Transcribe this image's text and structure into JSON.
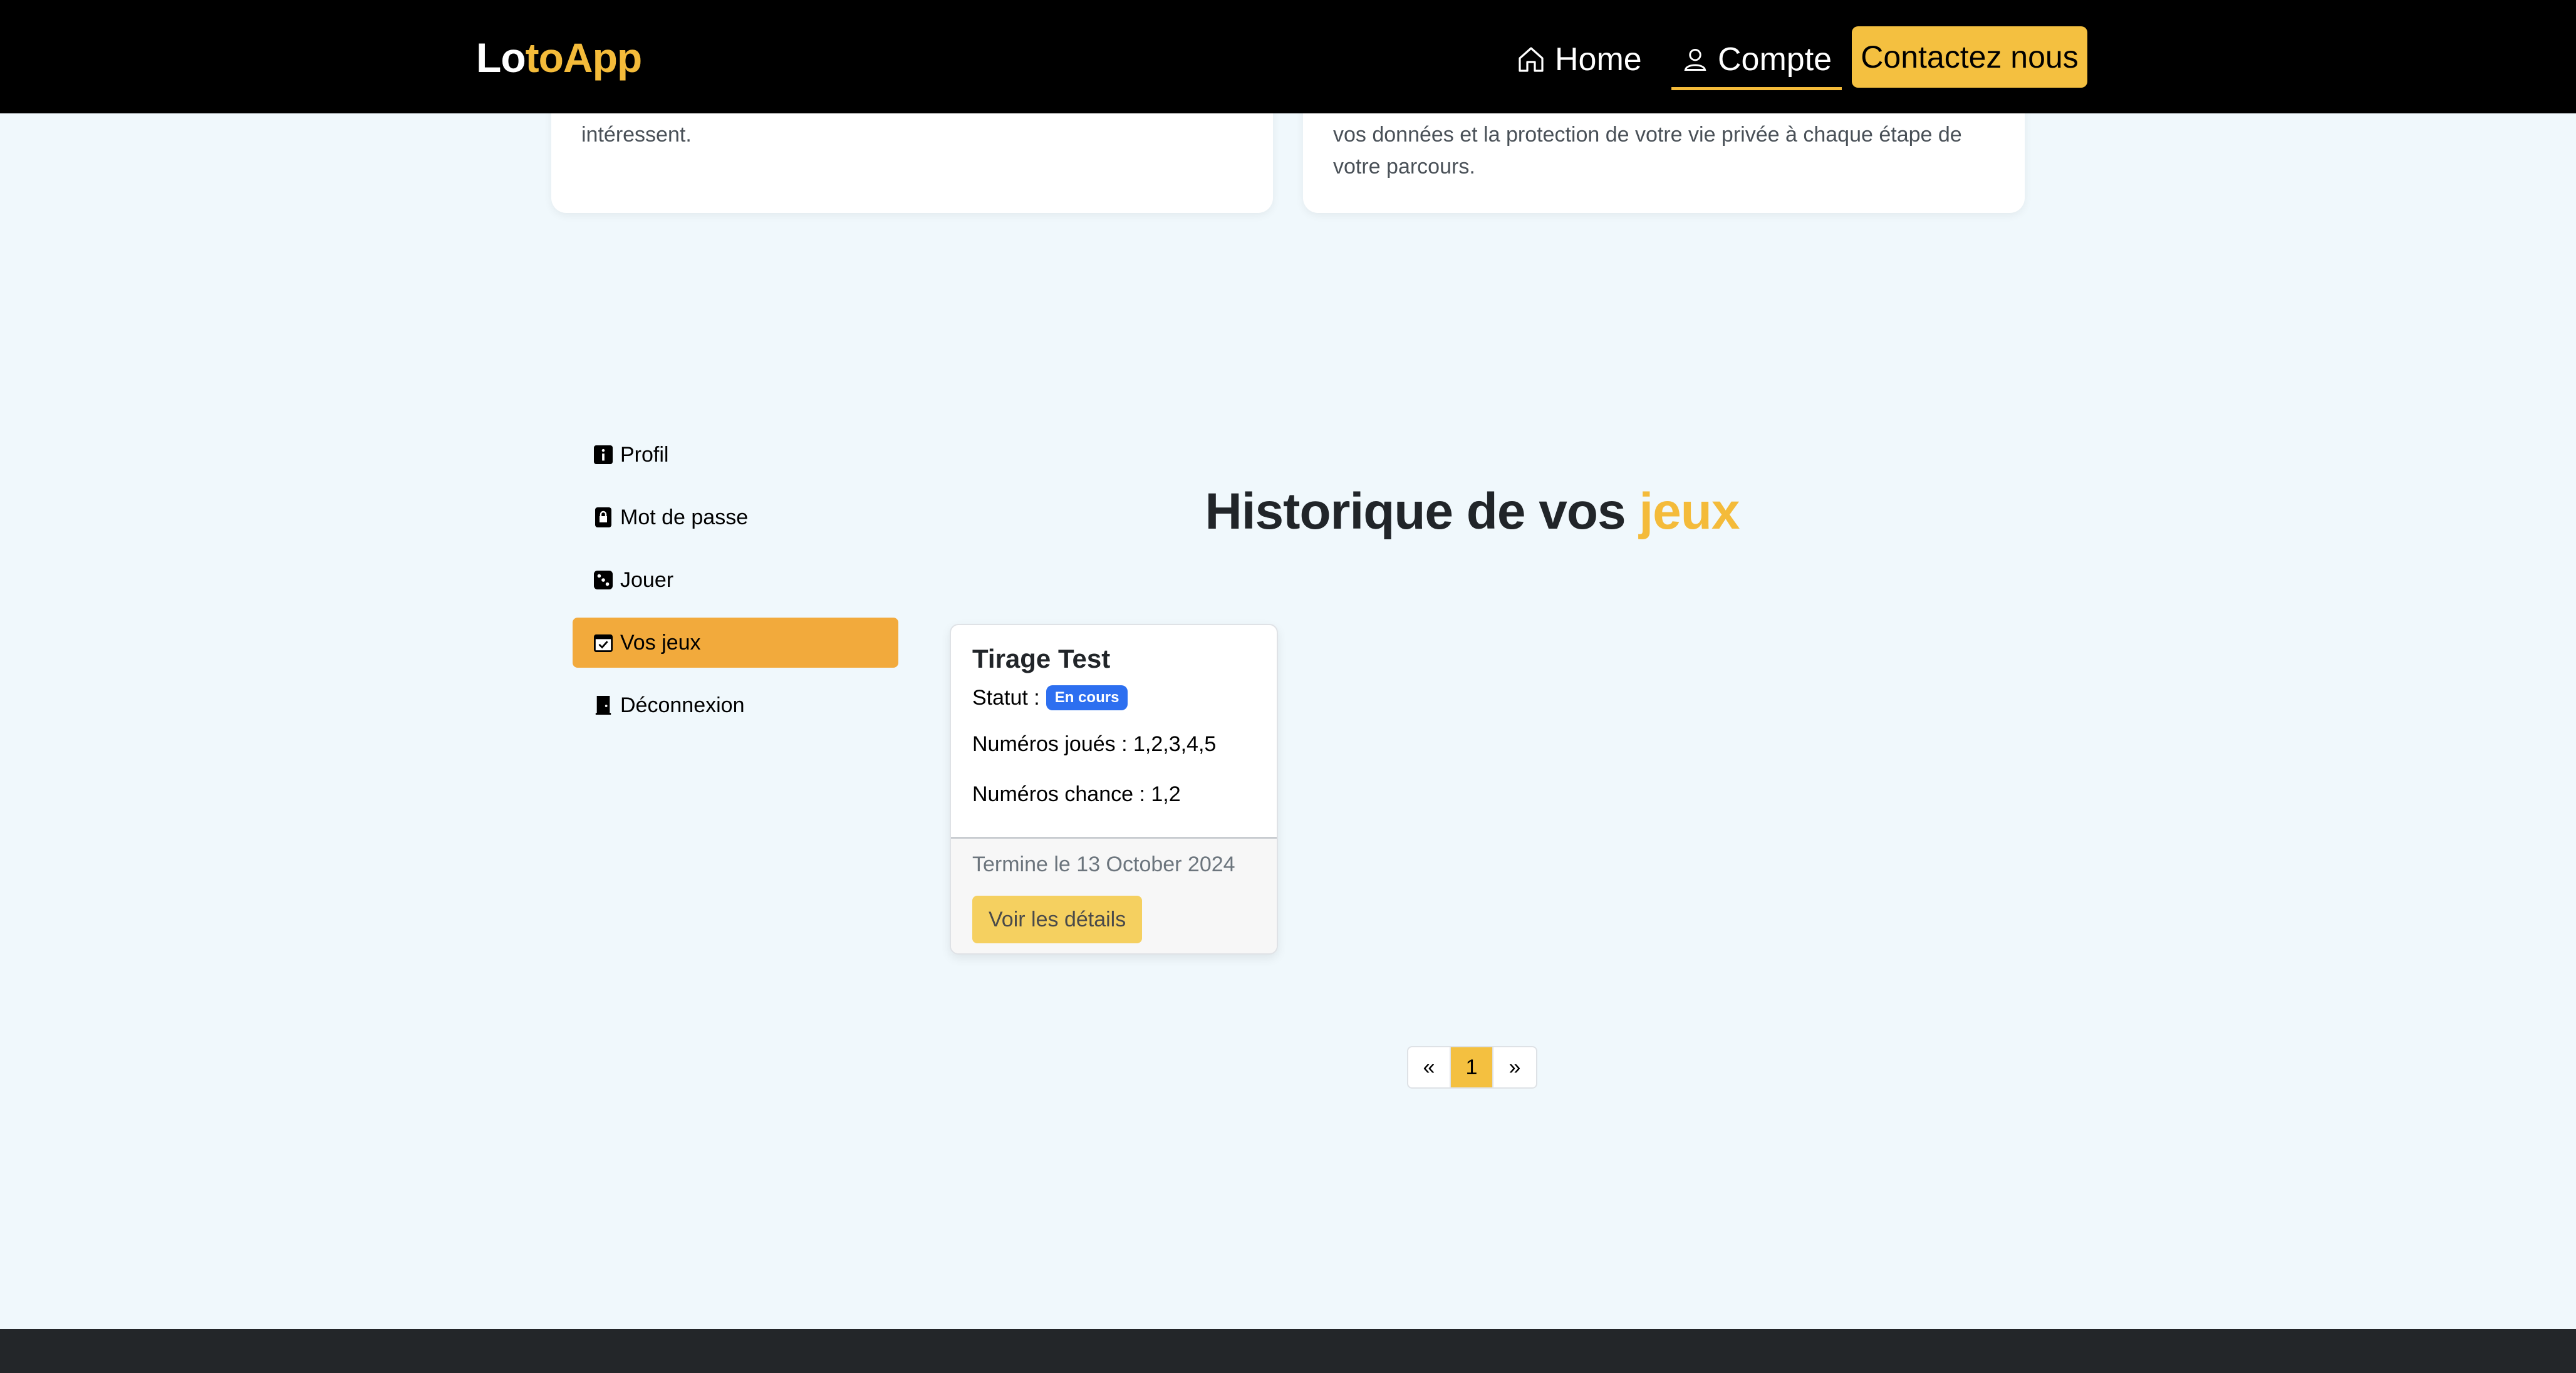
{
  "navbar": {
    "brand_white": "Lo",
    "brand_yellow": "toApp",
    "home_label": "Home",
    "compte_label": "Compte",
    "contact_label": "Contactez nous",
    "accent_color": "#f4bb3a"
  },
  "top_cards": {
    "left_text": "intéressent.",
    "right_text": "vos données et la protection de votre vie privée à chaque étape de votre parcours."
  },
  "sidebar": {
    "items": [
      {
        "label": "Profil",
        "icon": "info-icon"
      },
      {
        "label": "Mot de passe",
        "icon": "lock-icon"
      },
      {
        "label": "Jouer",
        "icon": "dice-icon"
      },
      {
        "label": "Vos jeux",
        "icon": "calendar-check-icon",
        "active": true
      },
      {
        "label": "Déconnexion",
        "icon": "door-icon"
      }
    ]
  },
  "main": {
    "title_dark": "Historique de vos",
    "title_accent": "jeux"
  },
  "game_card": {
    "title": "Tirage Test",
    "status_label": "Statut :",
    "status_badge": "En cours",
    "numbers_played": "Numéros joués : 1,2,3,4,5",
    "chance_numbers": "Numéros chance : 1,2",
    "end_date": "Termine le 13 October 2024",
    "details_button": "Voir les détails"
  },
  "pagination": {
    "prev": "«",
    "current": "1",
    "next": "»"
  }
}
